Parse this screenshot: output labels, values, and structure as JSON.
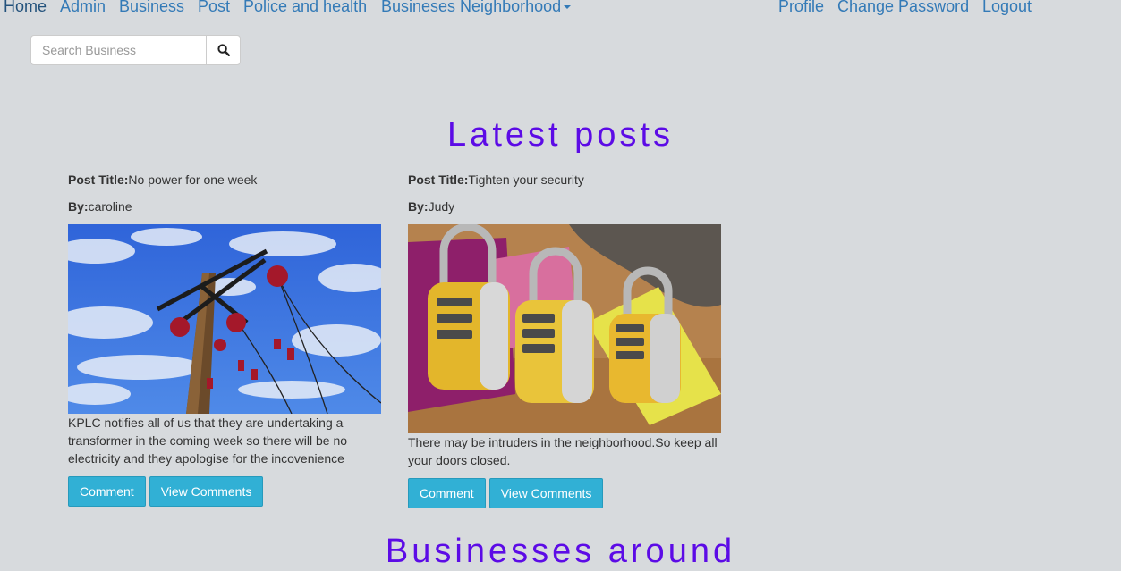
{
  "nav": {
    "left": [
      "Home",
      "Admin",
      "Business",
      "Post",
      "Police and health",
      "Busineses Neighborhood"
    ],
    "right": [
      "Profile",
      "Change Password",
      "Logout"
    ]
  },
  "search": {
    "placeholder": "Search Business",
    "icon": "search-icon"
  },
  "latest_title": "Latest posts",
  "posts": [
    {
      "title_label": "Post Title:",
      "title": "No power for one week",
      "by_label": "By:",
      "author": "caroline",
      "image": "power-lines-photo",
      "description": "KPLC notifies all of us that they are undertaking a transformer in the coming week so there will be no electricity and they apologise for the incovenience",
      "comment_label": "Comment",
      "view_label": "View Comments"
    },
    {
      "title_label": "Post Title:",
      "title": "Tighten your security",
      "by_label": "By:",
      "author": "Judy",
      "image": "padlocks-photo",
      "description": "There may be intruders in the neighborhood.So keep all your doors closed.",
      "comment_label": "Comment",
      "view_label": "View Comments"
    }
  ],
  "businesses_title": "Businesses around",
  "colors": {
    "accent": "#5c0be6",
    "link": "#337ab7",
    "button": "#31b0d5"
  }
}
